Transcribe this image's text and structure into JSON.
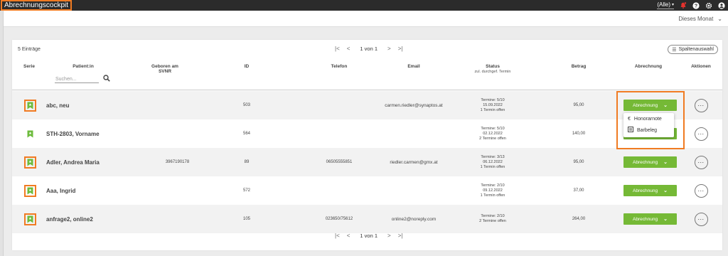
{
  "app": {
    "title": "Abrechnungscockpit",
    "filter": "(Alle)"
  },
  "subbar": {
    "period": "Dieses Monat"
  },
  "table": {
    "count": "5 Einträge",
    "pager": {
      "text": "1 von 1"
    },
    "column_select_label": "Spaltenauswahl",
    "search_placeholder": "Suchen...",
    "headers": {
      "serie": "Serie",
      "patient": "Patient:in",
      "born": "Geboren am",
      "svnr": "SVNR",
      "id": "ID",
      "phone": "Telefon",
      "email": "Email",
      "status": "Status",
      "status_sub": "zul. durchgef. Termin",
      "amount": "Betrag",
      "billing": "Abrechnung",
      "actions": "Aktionen"
    },
    "rows": [
      {
        "name": "abc, neu",
        "svnr": "",
        "id": "503",
        "phone": "",
        "email": "carmen.riedler@synaptos.at",
        "status1": "Termine: 5/10",
        "status2": "15.09.2022",
        "status3": "1 Termin offen",
        "amount": "95,00",
        "billing": "Abrechnung"
      },
      {
        "name": "STH-2803, Vorname",
        "svnr": "",
        "id": "564",
        "phone": "",
        "email": "",
        "status1": "Termine: 5/10",
        "status2": "02.12.2022",
        "status3": "2 Termine offen",
        "amount": "140,00",
        "billing": "Abrechnung"
      },
      {
        "name": "Adler, Andrea Maria",
        "svnr": "3967190178",
        "id": "89",
        "phone": "06505555851",
        "email": "riedler.carmen@gmx.at",
        "status1": "Termine: 3/13",
        "status2": "06.12.2022",
        "status3": "1 Termin offen",
        "amount": "95,00",
        "billing": "Abrechnung"
      },
      {
        "name": "Aaa, Ingrid",
        "svnr": "",
        "id": "572",
        "phone": "",
        "email": "",
        "status1": "Termine: 2/10",
        "status2": "09.12.2022",
        "status3": "1 Termin offen",
        "amount": "37,00",
        "billing": "Abrechnung"
      },
      {
        "name": "anfrage2, online2",
        "svnr": "",
        "id": "105",
        "phone": "023650/75612",
        "email": "online2@noreply.com",
        "status1": "Termine: 2/10",
        "status2": "",
        "status3": "2 Termine offen",
        "amount": "264,00",
        "billing": "Abrechnung"
      }
    ],
    "actions_glyph": "..."
  },
  "dropdown": {
    "items": [
      {
        "icon": "euro-icon",
        "glyph": "€",
        "label": "Honorarnote"
      },
      {
        "icon": "receipt-icon",
        "label": "Barbeleg"
      }
    ]
  },
  "colors": {
    "accent_orange": "#f07b22",
    "button_green": "#75b936",
    "topbar": "#2b2b2b",
    "notification_red": "#e5322d"
  }
}
